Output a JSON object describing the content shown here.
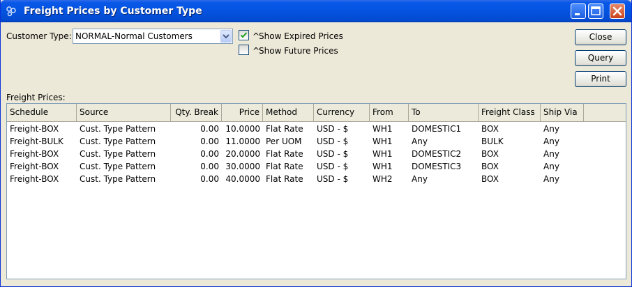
{
  "window": {
    "title": "Freight Prices by Customer Type"
  },
  "filters": {
    "customer_type_label": "Customer Type:",
    "customer_type_value": "NORMAL-Normal Customers",
    "show_expired": {
      "prefix": "^",
      "label": "Show Expired Prices",
      "checked": true
    },
    "show_future": {
      "prefix": "^",
      "label": "Show Future Prices",
      "checked": false
    }
  },
  "buttons": {
    "close": "Close",
    "query": "Query",
    "print": "Print"
  },
  "grid": {
    "label": "Freight Prices:",
    "columns": [
      "Schedule",
      "Source",
      "Qty. Break",
      "Price",
      "Method",
      "Currency",
      "From",
      "To",
      "Freight Class",
      "Ship Via"
    ],
    "rows": [
      [
        "Freight-BOX",
        "Cust. Type Pattern",
        "0.00",
        "10.0000",
        "Flat Rate",
        "USD - $",
        "WH1",
        "DOMESTIC1",
        "BOX",
        "Any"
      ],
      [
        "Freight-BULK",
        "Cust. Type Pattern",
        "0.00",
        "11.0000",
        "Per UOM",
        "USD - $",
        "WH1",
        "Any",
        "BULK",
        "Any"
      ],
      [
        "Freight-BOX",
        "Cust. Type Pattern",
        "0.00",
        "20.0000",
        "Flat Rate",
        "USD - $",
        "WH1",
        "DOMESTIC2",
        "BOX",
        "Any"
      ],
      [
        "Freight-BOX",
        "Cust. Type Pattern",
        "0.00",
        "30.0000",
        "Flat Rate",
        "USD - $",
        "WH1",
        "DOMESTIC3",
        "BOX",
        "Any"
      ],
      [
        "Freight-BOX",
        "Cust. Type Pattern",
        "0.00",
        "40.0000",
        "Flat Rate",
        "USD - $",
        "WH2",
        "Any",
        "BOX",
        "Any"
      ]
    ]
  }
}
